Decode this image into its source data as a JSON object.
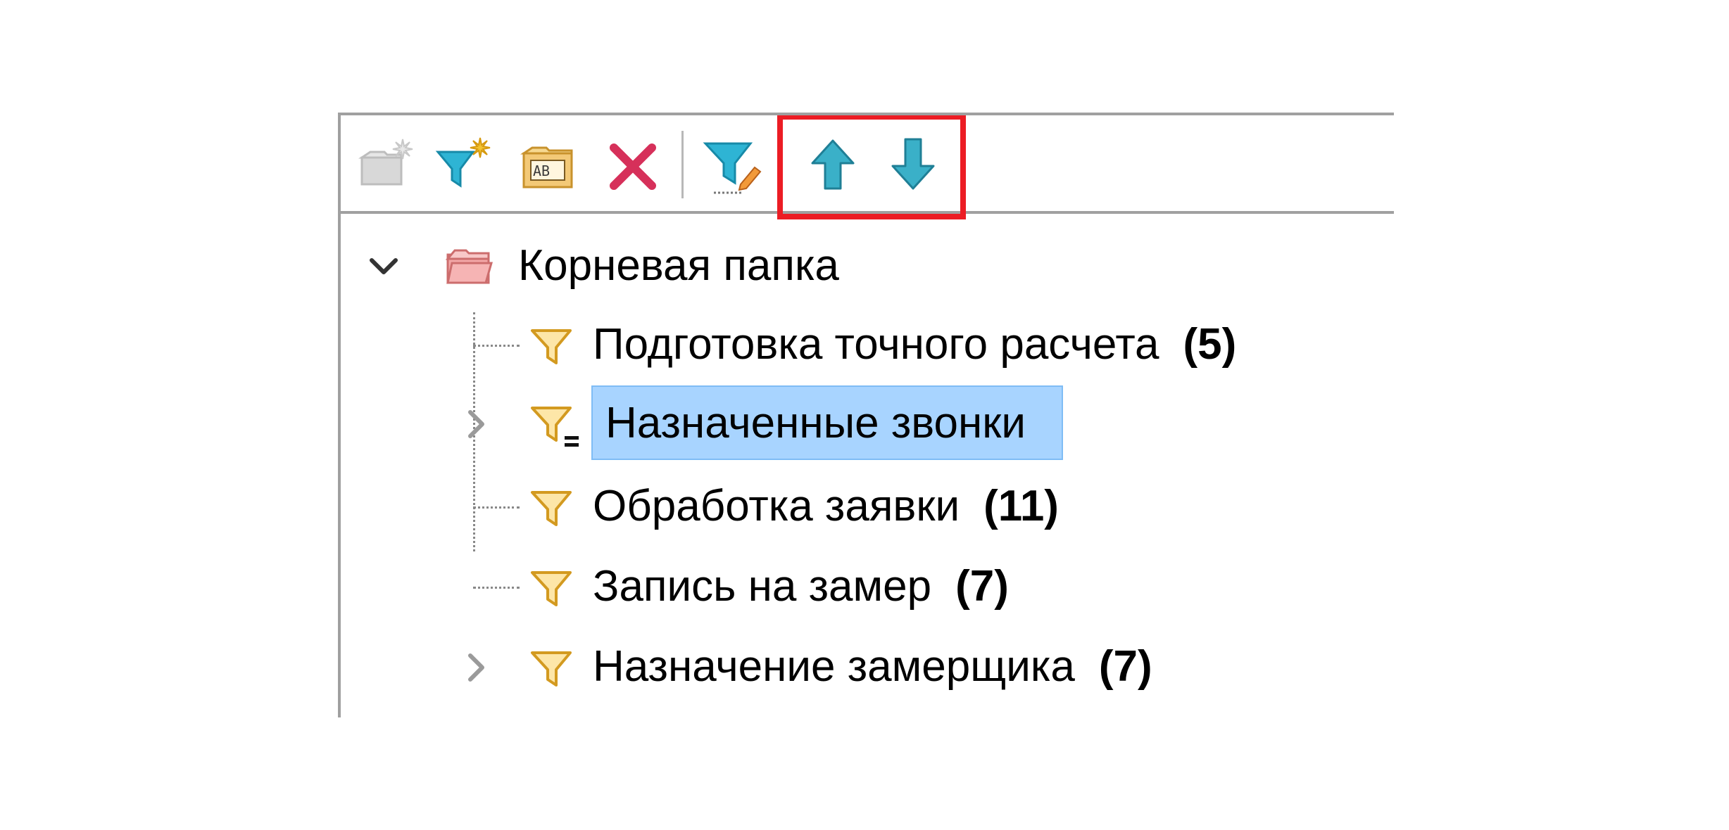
{
  "toolbar": {
    "buttons": [
      {
        "name": "add-folder",
        "icon": "new-folder-icon",
        "enabled": false
      },
      {
        "name": "add-filter",
        "icon": "new-filter-icon",
        "enabled": true
      },
      {
        "name": "rename",
        "icon": "rename-icon",
        "enabled": true
      },
      {
        "name": "delete",
        "icon": "delete-icon",
        "enabled": true
      },
      {
        "name": "edit-filter",
        "icon": "edit-filter-icon",
        "enabled": true
      },
      {
        "name": "move-up",
        "icon": "arrow-up-icon",
        "enabled": true
      },
      {
        "name": "move-down",
        "icon": "arrow-down-icon",
        "enabled": true
      }
    ],
    "highlight_color": "#ec1c24"
  },
  "tree": {
    "root": {
      "label": "Корневая папка",
      "icon": "folder-icon",
      "expanded": true
    },
    "items": [
      {
        "label": "Подготовка точного расчета",
        "count": "(5)",
        "icon": "filter-icon",
        "expandable": false,
        "selected": false
      },
      {
        "label": "Назначенные звонки",
        "count": "",
        "icon": "filter-list-icon",
        "expandable": true,
        "selected": true
      },
      {
        "label": "Обработка заявки",
        "count": "(11)",
        "icon": "filter-icon",
        "expandable": false,
        "selected": false
      },
      {
        "label": "Запись на замер",
        "count": "(7)",
        "icon": "filter-icon",
        "expandable": false,
        "selected": false
      },
      {
        "label": "Назначение замерщика",
        "count": "(7)",
        "icon": "filter-icon",
        "expandable": true,
        "selected": false
      }
    ],
    "selection_color": "#a8d4ff"
  }
}
